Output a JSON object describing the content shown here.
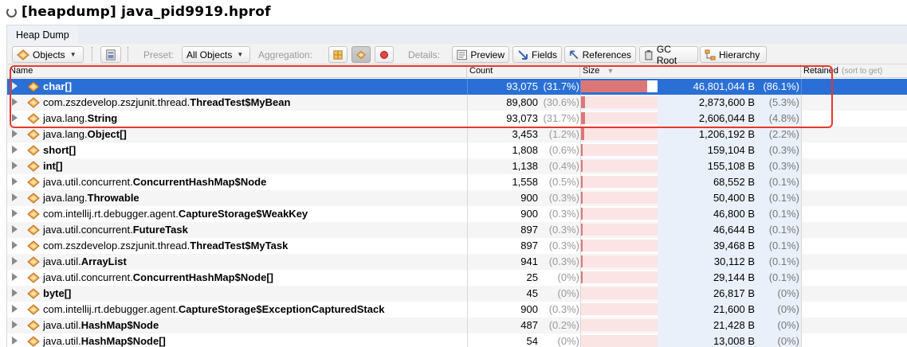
{
  "window": {
    "title": "[heapdump] java_pid9919.hprof"
  },
  "tabs": [
    {
      "label": "Heap Dump"
    }
  ],
  "toolbar": {
    "view_dropdown": "Objects",
    "preset_label": "Preset:",
    "preset_value": "All Objects",
    "aggregation_label": "Aggregation:",
    "details_label": "Details:",
    "preview": "Preview",
    "fields": "Fields",
    "references": "References",
    "gc_root": "GC Root",
    "hierarchy": "Hierarchy"
  },
  "table": {
    "columns": {
      "name": "Name",
      "count": "Count",
      "size": "Size",
      "retained": "Retained",
      "retained_note": "(sort to get)"
    },
    "rows": [
      {
        "pkg": "",
        "cls": "char[]",
        "count": "93,075",
        "count_pct": "(31.7%)",
        "size": "46,801,044 B",
        "size_pct": "(86.1%)",
        "size_frac": 0.861,
        "selected": true
      },
      {
        "pkg": "com.zszdevelop.zszjunit.thread.",
        "cls": "ThreadTest$MyBean",
        "count": "89,800",
        "count_pct": "(30.6%)",
        "size": "2,873,600 B",
        "size_pct": "(5.3%)",
        "size_frac": 0.053
      },
      {
        "pkg": "java.lang.",
        "cls": "String",
        "count": "93,073",
        "count_pct": "(31.7%)",
        "size": "2,606,044 B",
        "size_pct": "(4.8%)",
        "size_frac": 0.048
      },
      {
        "pkg": "java.lang.",
        "cls": "Object[]",
        "count": "3,453",
        "count_pct": "(1.2%)",
        "size": "1,206,192 B",
        "size_pct": "(2.2%)",
        "size_frac": 0.022
      },
      {
        "pkg": "",
        "cls": "short[]",
        "count": "1,808",
        "count_pct": "(0.6%)",
        "size": "159,104 B",
        "size_pct": "(0.3%)",
        "size_frac": 0.003
      },
      {
        "pkg": "",
        "cls": "int[]",
        "count": "1,138",
        "count_pct": "(0.4%)",
        "size": "155,108 B",
        "size_pct": "(0.3%)",
        "size_frac": 0.003
      },
      {
        "pkg": "java.util.concurrent.",
        "cls": "ConcurrentHashMap$Node",
        "count": "1,558",
        "count_pct": "(0.5%)",
        "size": "68,552 B",
        "size_pct": "(0.1%)",
        "size_frac": 0.001
      },
      {
        "pkg": "java.lang.",
        "cls": "Throwable",
        "count": "900",
        "count_pct": "(0.3%)",
        "size": "50,400 B",
        "size_pct": "(0.1%)",
        "size_frac": 0.001
      },
      {
        "pkg": "com.intellij.rt.debugger.agent.",
        "cls": "CaptureStorage$WeakKey",
        "count": "900",
        "count_pct": "(0.3%)",
        "size": "46,800 B",
        "size_pct": "(0.1%)",
        "size_frac": 0.001
      },
      {
        "pkg": "java.util.concurrent.",
        "cls": "FutureTask",
        "count": "897",
        "count_pct": "(0.3%)",
        "size": "46,644 B",
        "size_pct": "(0.1%)",
        "size_frac": 0.001
      },
      {
        "pkg": "com.zszdevelop.zszjunit.thread.",
        "cls": "ThreadTest$MyTask",
        "count": "897",
        "count_pct": "(0.3%)",
        "size": "39,468 B",
        "size_pct": "(0.1%)",
        "size_frac": 0.001
      },
      {
        "pkg": "java.util.",
        "cls": "ArrayList",
        "count": "941",
        "count_pct": "(0.3%)",
        "size": "30,112 B",
        "size_pct": "(0.1%)",
        "size_frac": 0.001
      },
      {
        "pkg": "java.util.concurrent.",
        "cls": "ConcurrentHashMap$Node[]",
        "count": "25",
        "count_pct": "(0%)",
        "size": "29,144 B",
        "size_pct": "(0.1%)",
        "size_frac": 0.001
      },
      {
        "pkg": "",
        "cls": "byte[]",
        "count": "45",
        "count_pct": "(0%)",
        "size": "26,817 B",
        "size_pct": "(0%)",
        "size_frac": 0
      },
      {
        "pkg": "com.intellij.rt.debugger.agent.",
        "cls": "CaptureStorage$ExceptionCapturedStack",
        "count": "900",
        "count_pct": "(0.3%)",
        "size": "21,600 B",
        "size_pct": "(0%)",
        "size_frac": 0
      },
      {
        "pkg": "java.util.",
        "cls": "HashMap$Node",
        "count": "487",
        "count_pct": "(0.2%)",
        "size": "21,428 B",
        "size_pct": "(0%)",
        "size_frac": 0
      },
      {
        "pkg": "java.util.",
        "cls": "HashMap$Node[]",
        "count": "54",
        "count_pct": "(0%)",
        "size": "13,008 B",
        "size_pct": "(0%)",
        "size_frac": 0
      }
    ]
  },
  "colors": {
    "selection": "#2a6fd6",
    "bar_fill": "#dd7777",
    "bar_track": "#fbe4e4",
    "annotation": "#e8372b"
  }
}
